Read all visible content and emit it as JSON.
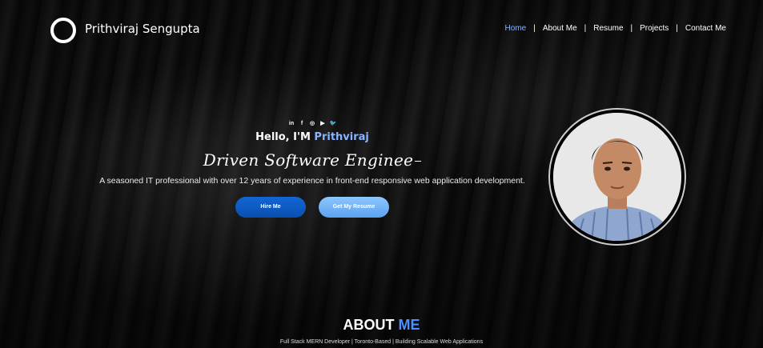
{
  "brand": {
    "name": "Prithviraj Sengupta"
  },
  "nav": {
    "links": [
      {
        "label": "Home",
        "active": true
      },
      {
        "label": "About Me",
        "active": false
      },
      {
        "label": "Resume",
        "active": false
      },
      {
        "label": "Projects",
        "active": false
      },
      {
        "label": "Contact Me",
        "active": false
      }
    ],
    "separator": "|"
  },
  "hero": {
    "socials": [
      {
        "icon": "linkedin-icon",
        "glyph": "in"
      },
      {
        "icon": "facebook-icon",
        "glyph": "f"
      },
      {
        "icon": "instagram-icon",
        "glyph": "◎"
      },
      {
        "icon": "youtube-icon",
        "glyph": "▶"
      },
      {
        "icon": "twitter-icon",
        "glyph": "🐦"
      }
    ],
    "greeting_prefix": "Hello, I'M ",
    "greeting_name": "Prithviraj",
    "role": "Driven Software Enginee",
    "tagline": "A seasoned IT professional with over 12 years of experience in front-end responsive web application development.",
    "hire_button": "Hire Me",
    "resume_button": "Get My Resume"
  },
  "about": {
    "heading_prefix": "ABOUT ",
    "heading_accent": "ME",
    "subtitle": "Full Stack MERN Developer | Toronto-Based | Building Scalable Web Applications"
  },
  "colors": {
    "accent": "#8ab4ff",
    "heading_accent": "#4d8eff",
    "primary_button": "#0a58c8",
    "secondary_button": "#6fb2f8"
  }
}
